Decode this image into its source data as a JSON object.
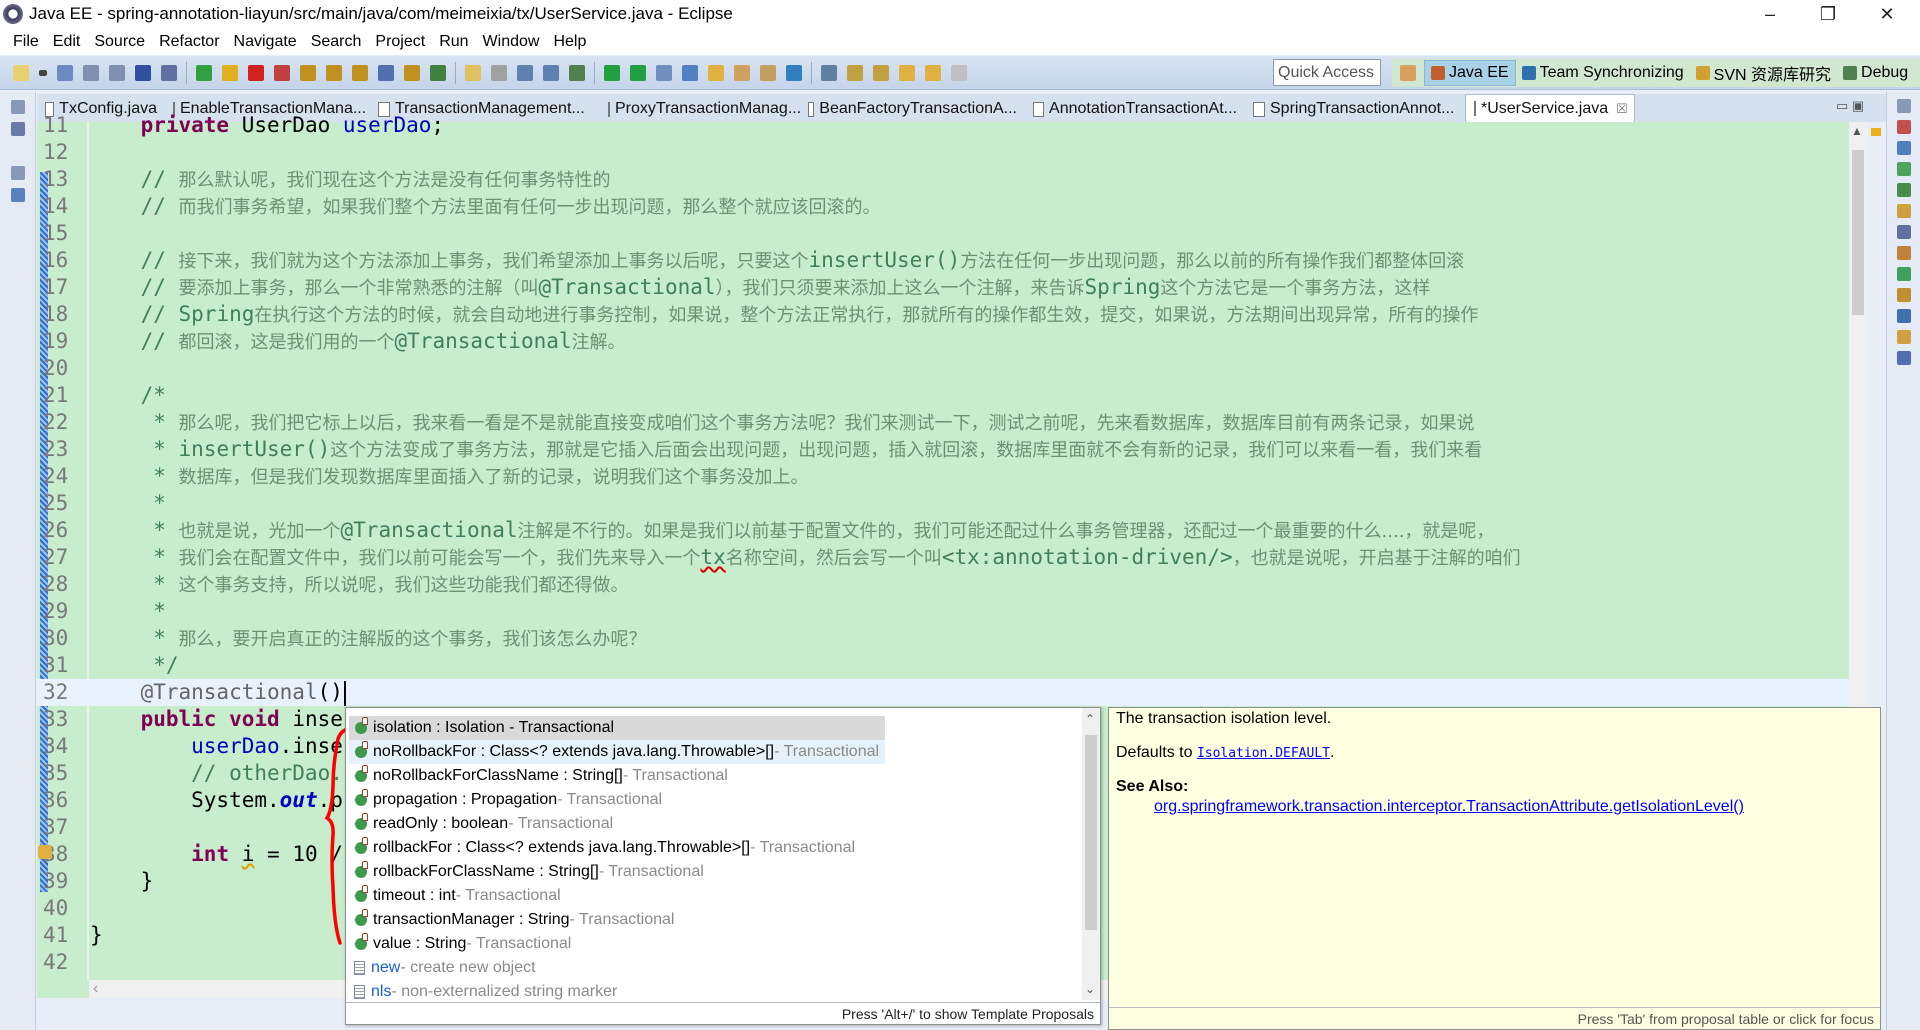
{
  "window": {
    "title": "Java EE - spring-annotation-liayun/src/main/java/com/meimeixia/tx/UserService.java - Eclipse",
    "minimize": "–",
    "maximize": "❐",
    "close": "✕"
  },
  "menu": [
    "File",
    "Edit",
    "Source",
    "Refactor",
    "Navigate",
    "Search",
    "Project",
    "Run",
    "Window",
    "Help"
  ],
  "toolbar": {
    "icons": [
      {
        "name": "new-icon",
        "color": "#e8d070"
      },
      {
        "name": "new-dropdown-icon",
        "color": "#444"
      },
      {
        "name": "open-type-icon",
        "color": "#6a8ac0"
      },
      {
        "name": "save-icon",
        "color": "#8090b0"
      },
      {
        "name": "save-all-icon",
        "color": "#8090b0"
      },
      {
        "name": "terminal-icon",
        "color": "#3050a0"
      },
      {
        "name": "skip-breakpoints-icon",
        "color": "#6070a0"
      },
      {
        "name": "resume-icon",
        "color": "#30a040"
      },
      {
        "name": "suspend-icon",
        "color": "#e0b020"
      },
      {
        "name": "terminate-icon",
        "color": "#d02020"
      },
      {
        "name": "disconnect-icon",
        "color": "#c04040"
      },
      {
        "name": "step-into-icon",
        "color": "#c09020"
      },
      {
        "name": "step-over-icon",
        "color": "#c09020"
      },
      {
        "name": "step-return-icon",
        "color": "#c09020"
      },
      {
        "name": "drop-to-frame-icon",
        "color": "#5070b0"
      },
      {
        "name": "use-step-filters-icon",
        "color": "#c09020"
      },
      {
        "name": "pin-icon",
        "color": "#408040"
      },
      {
        "name": "mark-occurrences-icon",
        "color": "#e0c060"
      },
      {
        "name": "block-selection-icon",
        "color": "#a0a0a0"
      },
      {
        "name": "show-whitespace-icon",
        "color": "#6080b0"
      },
      {
        "name": "paragraph-icon",
        "color": "#6080b0"
      },
      {
        "name": "debug-icon",
        "color": "#508050"
      },
      {
        "name": "run-icon",
        "color": "#20a040"
      },
      {
        "name": "run-external-icon",
        "color": "#20a040"
      },
      {
        "name": "new-java-project-icon",
        "color": "#7090c0"
      },
      {
        "name": "new-class-icon",
        "color": "#5080c0"
      },
      {
        "name": "open-folder-icon",
        "color": "#e0b040"
      },
      {
        "name": "open-task-icon",
        "color": "#d0a060"
      },
      {
        "name": "pen-icon",
        "color": "#c0a060"
      },
      {
        "name": "globe-icon",
        "color": "#3080c0"
      },
      {
        "name": "search-icon",
        "color": "#6080a0"
      },
      {
        "name": "next-annotation-icon",
        "color": "#c0a040"
      },
      {
        "name": "prev-annotation-icon",
        "color": "#c0a040"
      },
      {
        "name": "last-edit-icon",
        "color": "#e0b040"
      },
      {
        "name": "back-icon",
        "color": "#e0b040"
      },
      {
        "name": "forward-icon",
        "color": "#c0c0c0"
      }
    ]
  },
  "quick_access": {
    "placeholder": "Quick Access"
  },
  "perspectives": [
    {
      "label": "Java EE",
      "selected": true,
      "color": "#c06030"
    },
    {
      "label": "Team Synchronizing",
      "selected": false,
      "color": "#3070b0"
    },
    {
      "label": "SVN 资源库研究",
      "selected": false,
      "color": "#d0a030"
    },
    {
      "label": "Debug",
      "selected": false,
      "color": "#508050"
    }
  ],
  "tabs": [
    {
      "label": "TxConfig.java",
      "active": false
    },
    {
      "label": "EnableTransactionMana...",
      "active": false
    },
    {
      "label": "TransactionManagement...",
      "active": false
    },
    {
      "label": "ProxyTransactionManag...",
      "active": false
    },
    {
      "label": "BeanFactoryTransactionA...",
      "active": false
    },
    {
      "label": "AnnotationTransactionAt...",
      "active": false
    },
    {
      "label": "SpringTransactionAnnot...",
      "active": false
    },
    {
      "label": "*UserService.java",
      "active": true,
      "close": "☒"
    }
  ],
  "code": {
    "current_line": 32,
    "lines": [
      {
        "n": "11",
        "tokens": [
          {
            "t": "    ",
            "c": "pl"
          },
          {
            "t": "private",
            "c": "kw"
          },
          {
            "t": " UserDao ",
            "c": "pl"
          },
          {
            "t": "userDao",
            "c": "fld"
          },
          {
            "t": ";",
            "c": "pl"
          }
        ]
      },
      {
        "n": "12",
        "tokens": []
      },
      {
        "n": "13",
        "tokens": [
          {
            "t": "    // ",
            "c": "cm"
          },
          {
            "t": "那么默认呢，我们现在这个方法是没有任何事务特性的",
            "c": "cmt"
          }
        ]
      },
      {
        "n": "14",
        "tokens": [
          {
            "t": "    // ",
            "c": "cm"
          },
          {
            "t": "而我们事务希望，如果我们整个方法里面有任何一步出现问题，那么整个就应该回滚的。",
            "c": "cmt"
          }
        ]
      },
      {
        "n": "15",
        "tokens": []
      },
      {
        "n": "16",
        "tokens": [
          {
            "t": "    // ",
            "c": "cm"
          },
          {
            "t": "接下来，我们就为这个方法添加上事务，我们希望添加上事务以后呢，只要这个",
            "c": "cmt"
          },
          {
            "t": "insertUser()",
            "c": "cm"
          },
          {
            "t": "方法在任何一步出现问题，那么以前的所有操作我们都整体回滚",
            "c": "cmt"
          }
        ]
      },
      {
        "n": "17",
        "tokens": [
          {
            "t": "    // ",
            "c": "cm"
          },
          {
            "t": "要添加上事务，那么一个非常熟悉的注解（叫",
            "c": "cmt"
          },
          {
            "t": "@Transactional",
            "c": "cm"
          },
          {
            "t": "），我们只须要来添加上这么一个注解，来告诉",
            "c": "cmt"
          },
          {
            "t": "Spring",
            "c": "cm"
          },
          {
            "t": "这个方法它是一个事务方法，这样",
            "c": "cmt"
          }
        ]
      },
      {
        "n": "18",
        "tokens": [
          {
            "t": "    // ",
            "c": "cm"
          },
          {
            "t": "Spring",
            "c": "cm"
          },
          {
            "t": "在执行这个方法的时候，就会自动地进行事务控制，如果说，整个方法正常执行，那就所有的操作都生效，提交，如果说，方法期间出现异常，所有的操作",
            "c": "cmt"
          }
        ]
      },
      {
        "n": "19",
        "tokens": [
          {
            "t": "    // ",
            "c": "cm"
          },
          {
            "t": "都回滚，这是我们用的一个",
            "c": "cmt"
          },
          {
            "t": "@Transactional",
            "c": "cm"
          },
          {
            "t": "注解。",
            "c": "cmt"
          }
        ]
      },
      {
        "n": "20",
        "tokens": []
      },
      {
        "n": "21",
        "tokens": [
          {
            "t": "    /*",
            "c": "cm"
          }
        ]
      },
      {
        "n": "22",
        "tokens": [
          {
            "t": "     * ",
            "c": "cm"
          },
          {
            "t": "那么呢，我们把它标上以后，我来看一看是不是就能直接变成咱们这个事务方法呢？我们来测试一下，测试之前呢，先来看数据库，数据库目前有两条记录，如果说",
            "c": "cmt"
          }
        ]
      },
      {
        "n": "23",
        "tokens": [
          {
            "t": "     * ",
            "c": "cm"
          },
          {
            "t": "insertUser()",
            "c": "cm"
          },
          {
            "t": "这个方法变成了事务方法，那就是它插入后面会出现问题，出现问题，插入就回滚，数据库里面就不会有新的记录，我们可以来看一看，我们来看",
            "c": "cmt"
          }
        ]
      },
      {
        "n": "24",
        "tokens": [
          {
            "t": "     * ",
            "c": "cm"
          },
          {
            "t": "数据库，但是我们发现数据库里面插入了新的记录，说明我们这个事务没加上。",
            "c": "cmt"
          }
        ]
      },
      {
        "n": "25",
        "tokens": [
          {
            "t": "     *",
            "c": "cm"
          }
        ]
      },
      {
        "n": "26",
        "tokens": [
          {
            "t": "     * ",
            "c": "cm"
          },
          {
            "t": "也就是说，光加一个",
            "c": "cmt"
          },
          {
            "t": "@Transactional",
            "c": "cm"
          },
          {
            "t": "注解是不行的。如果是我们以前基于配置文件的，我们可能还配过什么事务管理器，还配过一个最重要的什么....，就是呢，",
            "c": "cmt"
          }
        ]
      },
      {
        "n": "27",
        "tokens": [
          {
            "t": "     * ",
            "c": "cm"
          },
          {
            "t": "我们会在配置文件中，我们以前可能会写一个，我们先来导入一个",
            "c": "cmt"
          },
          {
            "t": "tx",
            "c": "cm sq"
          },
          {
            "t": "名称空间，然后会写一个叫",
            "c": "cmt"
          },
          {
            "t": "<tx:annotation-driven/>",
            "c": "cm"
          },
          {
            "t": "，也就是说呢，开启基于注解的咱们",
            "c": "cmt"
          }
        ]
      },
      {
        "n": "28",
        "tokens": [
          {
            "t": "     * ",
            "c": "cm"
          },
          {
            "t": "这个事务支持，所以说呢，我们这些功能我们都还得做。",
            "c": "cmt"
          }
        ]
      },
      {
        "n": "29",
        "tokens": [
          {
            "t": "     *",
            "c": "cm"
          }
        ]
      },
      {
        "n": "30",
        "tokens": [
          {
            "t": "     * ",
            "c": "cm"
          },
          {
            "t": "那么，要开启真正的注解版的这个事务，我们该怎么办呢？",
            "c": "cmt"
          }
        ]
      },
      {
        "n": "31",
        "tokens": [
          {
            "t": "     */",
            "c": "cm"
          }
        ]
      },
      {
        "n": "32",
        "tokens": [
          {
            "t": "    ",
            "c": "pl"
          },
          {
            "t": "@Transactional",
            "c": "ann"
          },
          {
            "t": "()",
            "c": "pl"
          }
        ]
      },
      {
        "n": "33",
        "tokens": [
          {
            "t": "    ",
            "c": "pl"
          },
          {
            "t": "public",
            "c": "kw"
          },
          {
            "t": " ",
            "c": "pl"
          },
          {
            "t": "void",
            "c": "kw"
          },
          {
            "t": " inse",
            "c": "pl"
          }
        ]
      },
      {
        "n": "34",
        "tokens": [
          {
            "t": "        ",
            "c": "pl"
          },
          {
            "t": "userDao",
            "c": "fld"
          },
          {
            "t": ".inse",
            "c": "pl"
          }
        ]
      },
      {
        "n": "35",
        "tokens": [
          {
            "t": "        // otherDao.",
            "c": "cm"
          }
        ]
      },
      {
        "n": "36",
        "tokens": [
          {
            "t": "        System.",
            "c": "pl"
          },
          {
            "t": "out",
            "c": "st"
          },
          {
            "t": ".p",
            "c": "pl"
          }
        ]
      },
      {
        "n": "37",
        "tokens": []
      },
      {
        "n": "38",
        "tokens": [
          {
            "t": "        ",
            "c": "pl"
          },
          {
            "t": "int",
            "c": "kw"
          },
          {
            "t": " ",
            "c": "pl"
          },
          {
            "t": "i",
            "c": "pl sqy"
          },
          {
            "t": " = 10 /",
            "c": "pl"
          }
        ]
      },
      {
        "n": "39",
        "tokens": [
          {
            "t": "    }",
            "c": "pl"
          }
        ]
      },
      {
        "n": "40",
        "tokens": []
      },
      {
        "n": "41",
        "tokens": [
          {
            "t": "}",
            "c": "pl"
          }
        ]
      },
      {
        "n": "42",
        "tokens": []
      }
    ]
  },
  "completion": {
    "items": [
      {
        "icon": "field",
        "main": "isolation : Isolation - Transactional",
        "suffix": "",
        "state": "selected"
      },
      {
        "icon": "field",
        "main": "noRollbackFor : Class<? extends java.lang.Throwable>[]",
        "suffix": " - Transactional",
        "state": "hover"
      },
      {
        "icon": "field",
        "main": "noRollbackForClassName : String[]",
        "suffix": " - Transactional",
        "state": ""
      },
      {
        "icon": "field",
        "main": "propagation : Propagation",
        "suffix": " - Transactional",
        "state": ""
      },
      {
        "icon": "field",
        "main": "readOnly : boolean",
        "suffix": " - Transactional",
        "state": ""
      },
      {
        "icon": "field",
        "main": "rollbackFor : Class<? extends java.lang.Throwable>[]",
        "suffix": " - Transactional",
        "state": ""
      },
      {
        "icon": "field",
        "main": "rollbackForClassName : String[]",
        "suffix": " - Transactional",
        "state": ""
      },
      {
        "icon": "field",
        "main": "timeout : int",
        "suffix": " - Transactional",
        "state": ""
      },
      {
        "icon": "field",
        "main": "transactionManager : String",
        "suffix": " - Transactional",
        "state": ""
      },
      {
        "icon": "field",
        "main": "value : String",
        "suffix": " - Transactional",
        "state": ""
      },
      {
        "icon": "template",
        "main": "new",
        "suffix": " - create new object",
        "state": ""
      },
      {
        "icon": "template",
        "main": "nls",
        "suffix": " - non-externalized string marker",
        "state": ""
      }
    ],
    "footer": "Press 'Alt+/' to show Template Proposals"
  },
  "doc": {
    "summary": "The transaction isolation level.",
    "defaults_prefix": "Defaults to ",
    "defaults_link": "Isolation.DEFAULT",
    "defaults_suffix": ".",
    "see_also_label": "See Also:",
    "see_also_link": "org.springframework.transaction.interceptor.TransactionAttribute.getIsolationLevel()",
    "footer": "Press 'Tab' from proposal table or click for focus"
  },
  "colors": {
    "editor_bg": "#c7edcc",
    "current_line": "#e8f2fe",
    "keyword": "#7f0055",
    "comment": "#3f7f5f",
    "field": "#0000c0",
    "annotation_mark": "#ff0000",
    "doc_bg": "#ffffe1"
  }
}
